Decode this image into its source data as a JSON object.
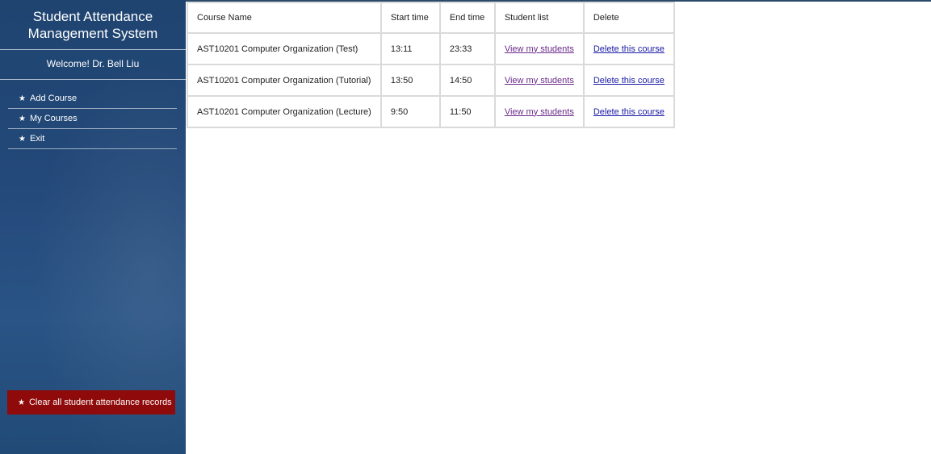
{
  "app": {
    "title_line1": "Student Attendance",
    "title_line2": "Management System",
    "welcome": "Welcome! Dr. Bell Liu"
  },
  "sidebar": {
    "items": [
      {
        "label": "Add Course",
        "icon": "star-icon"
      },
      {
        "label": "My Courses",
        "icon": "star-icon"
      },
      {
        "label": "Exit",
        "icon": "star-icon"
      }
    ],
    "danger_action": {
      "label": "Clear all student attendance records",
      "icon": "star-icon",
      "color": "#8f0a0a"
    }
  },
  "table": {
    "headers": [
      "Course Name",
      "Start time",
      "End time",
      "Student list",
      "Delete"
    ],
    "rows": [
      {
        "name": "AST10201 Computer Organization (Test)",
        "start": "13:11",
        "end": "23:33",
        "students_link": "View my students",
        "delete_link": "Delete this course"
      },
      {
        "name": "AST10201 Computer Organization (Tutorial)",
        "start": "13:50",
        "end": "14:50",
        "students_link": "View my students",
        "delete_link": "Delete this course"
      },
      {
        "name": "AST10201 Computer Organization (Lecture)",
        "start": "9:50",
        "end": "11:50",
        "students_link": "View my students",
        "delete_link": "Delete this course"
      }
    ]
  },
  "colors": {
    "sidebar_bg": "#23497a",
    "link_visited": "#6a2a8a",
    "link": "#1a1aa6"
  }
}
